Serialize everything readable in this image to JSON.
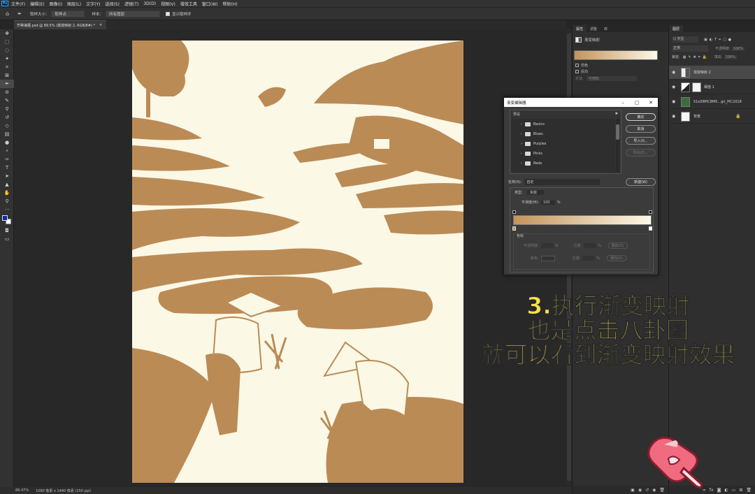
{
  "menubar": {
    "items": [
      "文件(F)",
      "编辑(E)",
      "图像(I)",
      "图层(L)",
      "文字(Y)",
      "选择(S)",
      "滤镜(T)",
      "3D(D)",
      "视图(V)",
      "增效工具",
      "窗口(W)",
      "帮助(H)"
    ]
  },
  "options": {
    "sample_size_label": "取样大小：",
    "sample_size_value": "取样点",
    "sample_label": "样本：",
    "sample_value": "所有图层",
    "show_ring_label": "显示取样环"
  },
  "document": {
    "tab_title": "芒种海报.psd @ 89.5% (渐变映射 2, RGB/8#) *"
  },
  "status": {
    "zoom": "89.47%",
    "info": "1080 像素 x 1440 像素 (150 ppi)"
  },
  "properties": {
    "tabs": [
      "属性",
      "调整",
      "库"
    ],
    "header": "渐变映射",
    "dither_label": "仿色",
    "reverse_label": "反向",
    "method_label": "方法:",
    "method_value": "可感知"
  },
  "layers": {
    "tab": "图层",
    "search_placeholder": "Q 类型",
    "blend_mode": "正常",
    "opacity_label": "不透明度:",
    "opacity_value": "100%",
    "lock_label": "锁定:",
    "fill_label": "填充:",
    "fill_value": "100%",
    "items": [
      {
        "name": "渐变映射 2"
      },
      {
        "name": "阈值 1"
      },
      {
        "name": "51e58PIC8M5...gn_PIC2018"
      },
      {
        "name": "背景"
      }
    ]
  },
  "dialog": {
    "title": "渐变编辑器",
    "preset_label": "预设",
    "presets": [
      "Basics",
      "Blues",
      "Purples",
      "Pinks",
      "Reds"
    ],
    "ok": "确定",
    "cancel": "取消",
    "import": "导入(I)...",
    "export": "导出(E)...",
    "name_label": "名称(N):",
    "name_value": "自定",
    "new_button": "新建(W)",
    "type_label": "类型：",
    "type_value": "实底",
    "smooth_label": "平滑度(M):",
    "smooth_value": "100",
    "smooth_unit": "%",
    "stops_label": "色标",
    "opacity_label": "不透明度:",
    "location_label": "位置:",
    "delete_label": "删除(D)",
    "color_label": "颜色:",
    "percent": "%",
    "gradient_start": "#c4945c",
    "gradient_end": "#fdf9e8"
  },
  "overlay": {
    "line1": "3.执行渐变映射",
    "line2": "也是点击八卦图",
    "line3": "就可以看到渐变映射效果"
  },
  "colors": {
    "ink": "#bb8b56",
    "paper": "#fbf8e6",
    "accent_yellow": "#f6e24a"
  }
}
